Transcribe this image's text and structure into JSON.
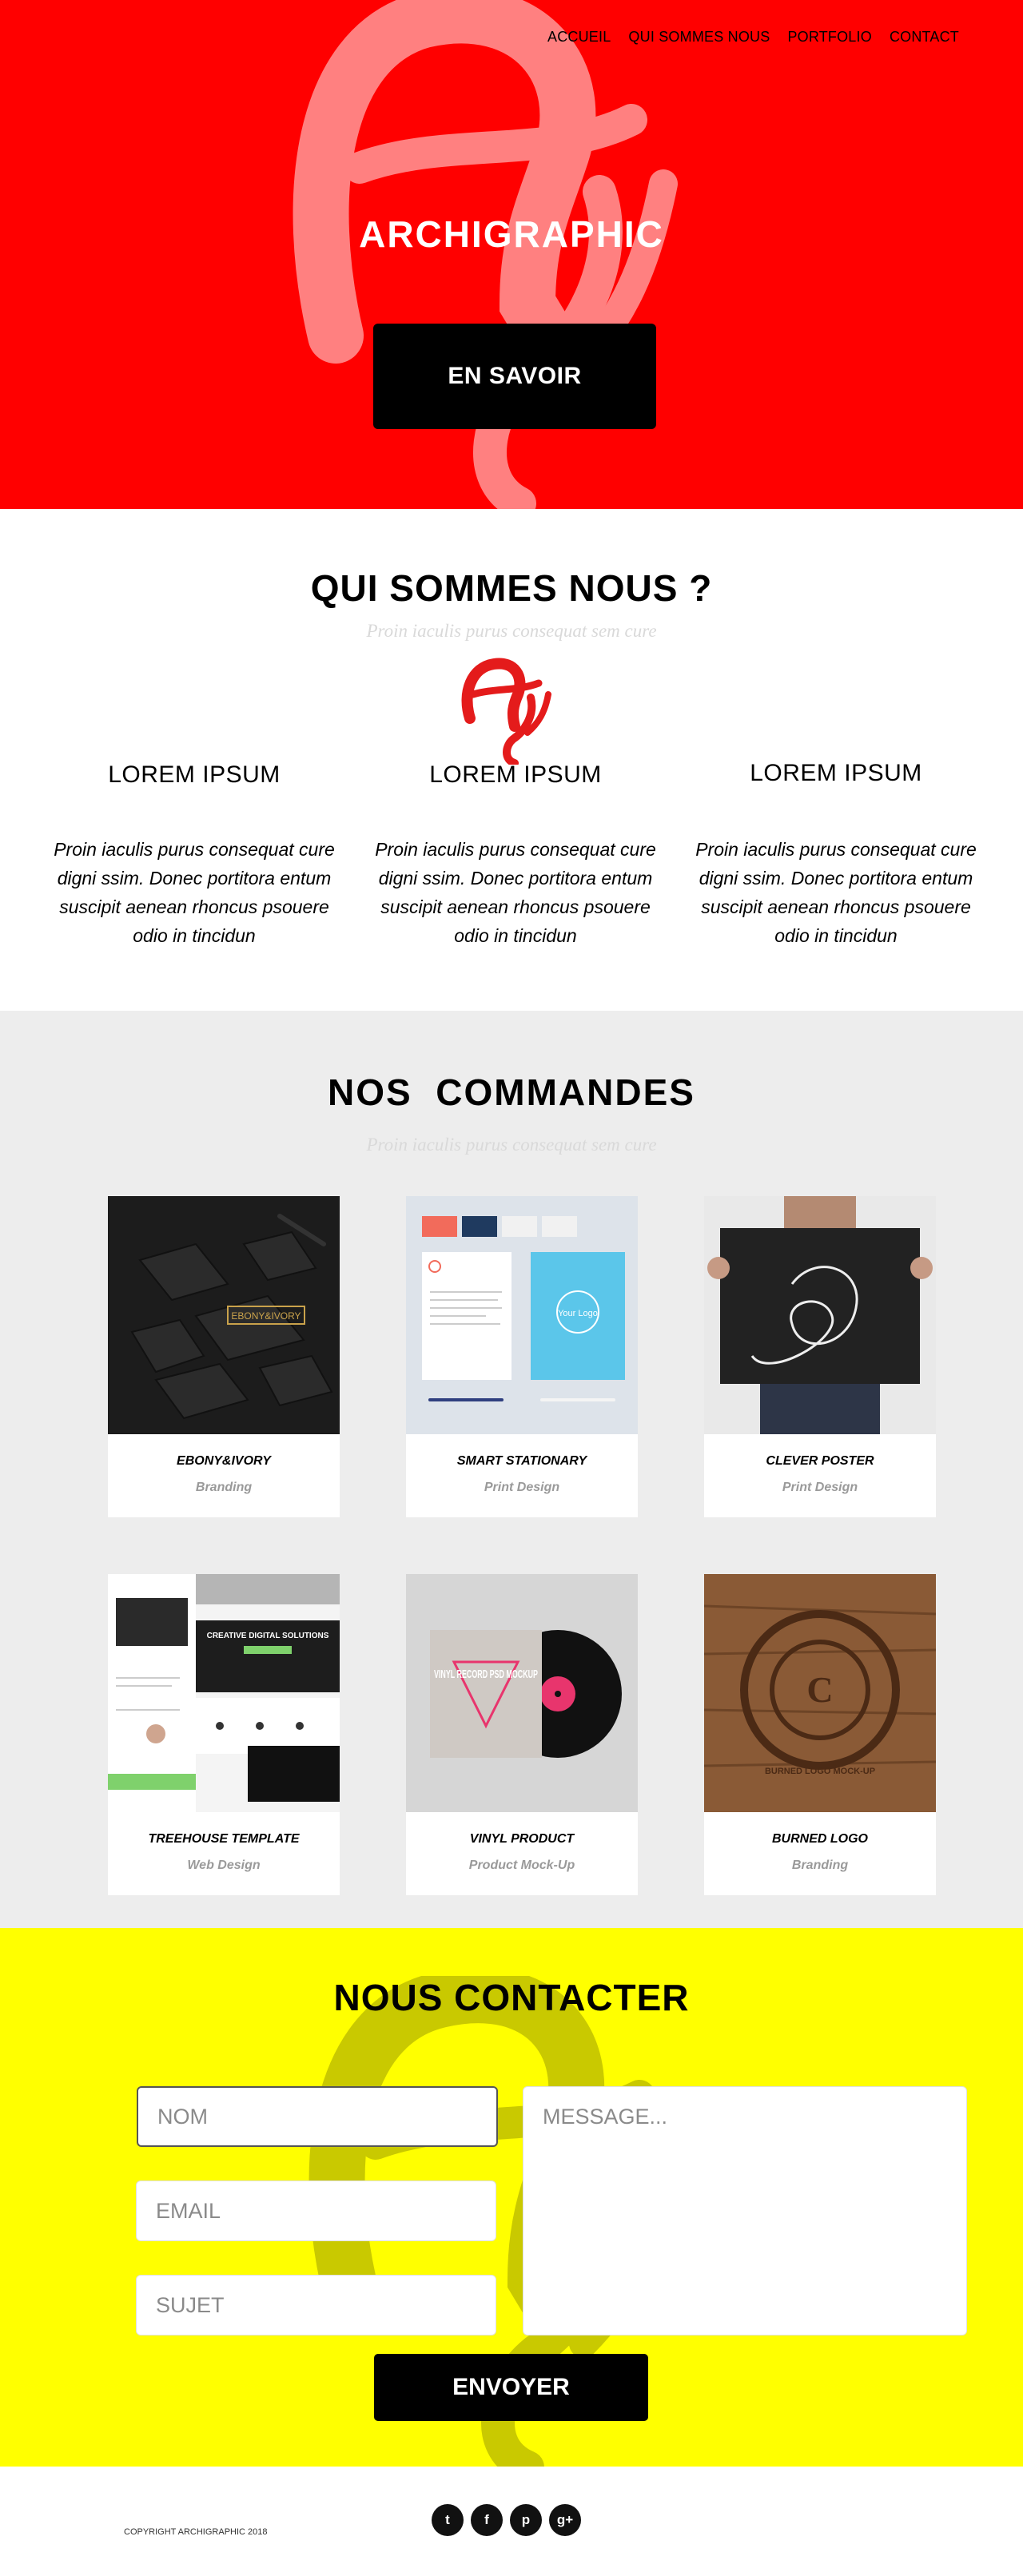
{
  "nav": {
    "items": [
      "ACCUEIL",
      "QUI SOMMES NOUS",
      "PORTFOLIO",
      "CONTACT"
    ]
  },
  "hero": {
    "brand": "ARCHIGRAPHIC",
    "cta_label": "EN SAVOIR",
    "background_color": "#ff0000"
  },
  "about": {
    "title": "QUI SOMMES NOUS ?",
    "subtitle": "Proin iaculis purus consequat sem cure",
    "columns": [
      {
        "heading": "LOREM IPSUM",
        "text": "Proin iaculis purus consequat cure digni ssim. Donec portitora entum suscipit aenean rhoncus psouere odio in tincidun"
      },
      {
        "heading": "LOREM IPSUM",
        "text": "Proin iaculis purus consequat cure digni ssim. Donec portitora entum suscipit aenean rhoncus psouere odio in tincidun"
      },
      {
        "heading": "LOREM IPSUM",
        "text": "Proin iaculis purus consequat cure digni ssim. Donec portitora entum suscipit aenean rhoncus psouere odio in tincidun"
      }
    ]
  },
  "orders": {
    "title": "NOS  COMMANDES",
    "subtitle": "Proin iaculis purus consequat sem cure",
    "items": [
      {
        "title": "EBONY&IVORY",
        "category": "Branding",
        "image_label": "EBONY&IVORY"
      },
      {
        "title": "SMART STATIONARY",
        "category": "Print Design",
        "image_label": "Your Logo"
      },
      {
        "title": "CLEVER POSTER",
        "category": "Print Design",
        "image_label": ""
      },
      {
        "title": "TREEHOUSE TEMPLATE",
        "category": "Web Design",
        "image_label": "CREATIVE DIGITAL SOLUTIONS"
      },
      {
        "title": "VINYL PRODUCT",
        "category": "Product Mock-Up",
        "image_label": "VINYL RECORD PSD MOCKUP"
      },
      {
        "title": "BURNED LOGO",
        "category": "Branding",
        "image_label": "BURNED LOGO MOCK-UP"
      }
    ]
  },
  "contact": {
    "title": "NOUS CONTACTER",
    "name_placeholder": "NOM",
    "email_placeholder": "EMAIL",
    "subject_placeholder": "SUJET",
    "message_placeholder": "MESSAGE...",
    "send_label": "ENVOYER",
    "background_color": "#ffff00"
  },
  "footer": {
    "copyright": "COPYRIGHT ARCHIGRAPHIC 2018",
    "socials": [
      {
        "icon": "twitter-icon",
        "glyph": "t"
      },
      {
        "icon": "facebook-icon",
        "glyph": "f"
      },
      {
        "icon": "pinterest-icon",
        "glyph": "p"
      },
      {
        "icon": "google-plus-icon",
        "glyph": "g+"
      }
    ]
  }
}
